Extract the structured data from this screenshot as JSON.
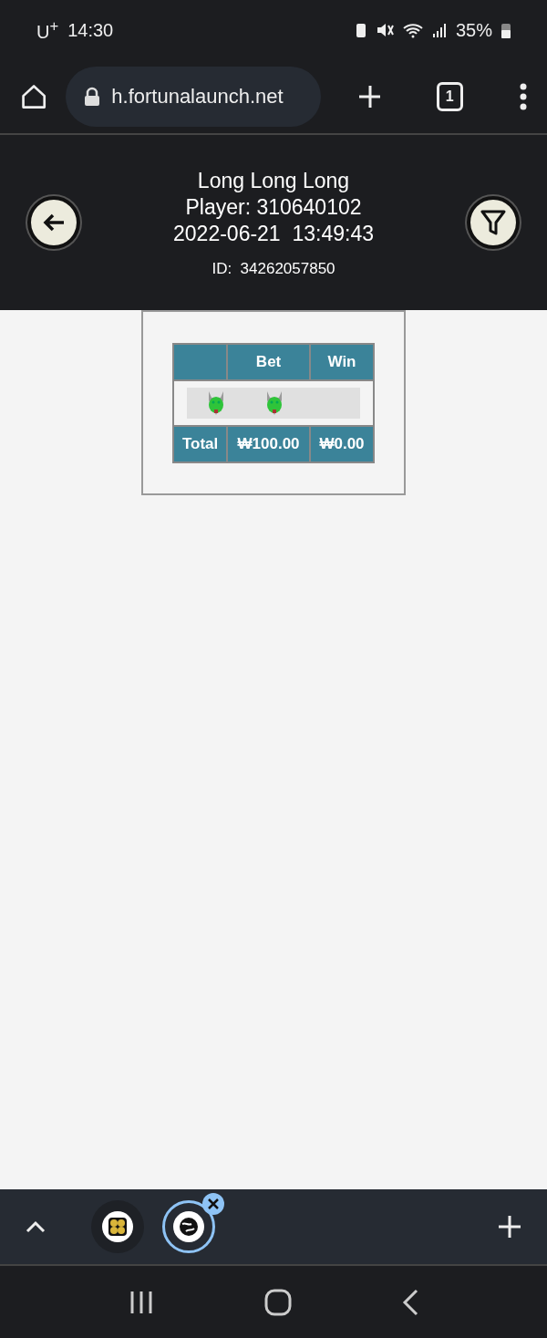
{
  "status_bar": {
    "carrier": "U$^{+}$",
    "time": "14:30",
    "battery": "35%"
  },
  "browser": {
    "url": "h.fortunalaunch.net",
    "tab_count": "1"
  },
  "header": {
    "title": "Long Long Long",
    "player": "Player: 310640102",
    "datetime": "2022-06-21  13:49:43",
    "id": "ID:  34262057850"
  },
  "table": {
    "columns": [
      "Bet",
      "Win"
    ],
    "total": {
      "label": "Total",
      "bet": "₩100.00",
      "win": "₩0.00"
    }
  },
  "tab_group": {
    "tabs": [
      {
        "kind": "clover",
        "selected": false
      },
      {
        "kind": "globe",
        "selected": true
      }
    ]
  }
}
